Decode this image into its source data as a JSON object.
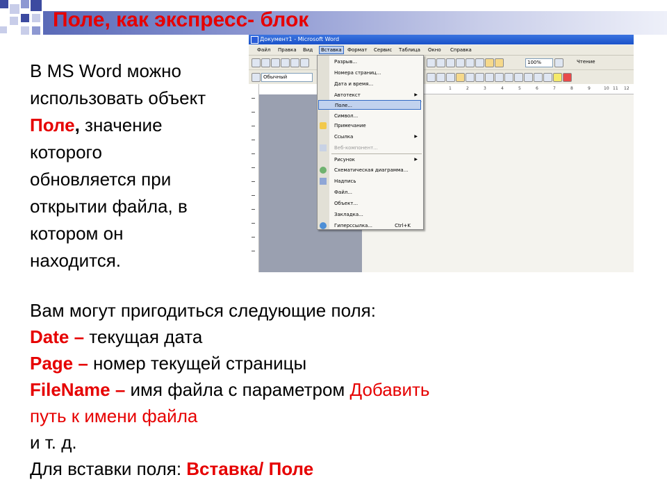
{
  "title": "Поле, как экспресс- блок",
  "intro": {
    "line1": "В MS Word можно",
    "line2": "использовать объект",
    "field_word": "Поле",
    "comma": ",",
    "line3_rest": " значение",
    "line4": "которого",
    "line5": "обновляется при",
    "line6": "открытии файла, в",
    "line7": "котором он",
    "line8": "находится."
  },
  "fields": {
    "heading": "Вам могут пригодиться следующие поля:",
    "date_key": "Date –",
    "date_desc": " текущая дата",
    "page_key": "Page –",
    "page_desc": " номер текущей страницы",
    "filename_key": "FileName –",
    "filename_desc": " имя файла с параметром ",
    "filename_param1": "Добавить",
    "filename_param2": "путь к имени файла",
    "etc": "и т. д.",
    "insert_prefix": "Для вставки поля: ",
    "insert_path": "Вставка/ Поле"
  },
  "word": {
    "window_title": "Документ1 - Microsoft Word",
    "menu": [
      "Файл",
      "Правка",
      "Вид",
      "Вставка",
      "Формат",
      "Сервис",
      "Таблица",
      "Окно",
      "Справка"
    ],
    "style_value": "Обычный",
    "zoom_value": "100%",
    "reading_label": "Чтение",
    "ruler_numbers": [
      "1",
      "2",
      "3",
      "4",
      "5",
      "6",
      "7",
      "8",
      "9",
      "10",
      "11",
      "12"
    ],
    "insert_menu": [
      {
        "label": "Разрыв...",
        "state": "normal"
      },
      {
        "label": "Номера страниц...",
        "state": "normal"
      },
      {
        "label": "Дата и время...",
        "state": "normal"
      },
      {
        "label": "Автотекст",
        "state": "sub"
      },
      {
        "label": "Поле...",
        "state": "hl"
      },
      {
        "label": "Символ...",
        "state": "normal"
      },
      {
        "label": "Примечание",
        "state": "normal"
      },
      {
        "label": "Ссылка",
        "state": "sub"
      },
      {
        "label": "Веб-компонент...",
        "state": "dis"
      },
      {
        "label": "Рисунок",
        "state": "sub"
      },
      {
        "label": "Схематическая диаграмма...",
        "state": "normal"
      },
      {
        "label": "Надпись",
        "state": "normal"
      },
      {
        "label": "Файл...",
        "state": "normal"
      },
      {
        "label": "Объект...",
        "state": "normal"
      },
      {
        "label": "Закладка...",
        "state": "normal"
      },
      {
        "label": "Гиперссылка...",
        "state": "normal",
        "shortcut": "Ctrl+K"
      }
    ]
  }
}
